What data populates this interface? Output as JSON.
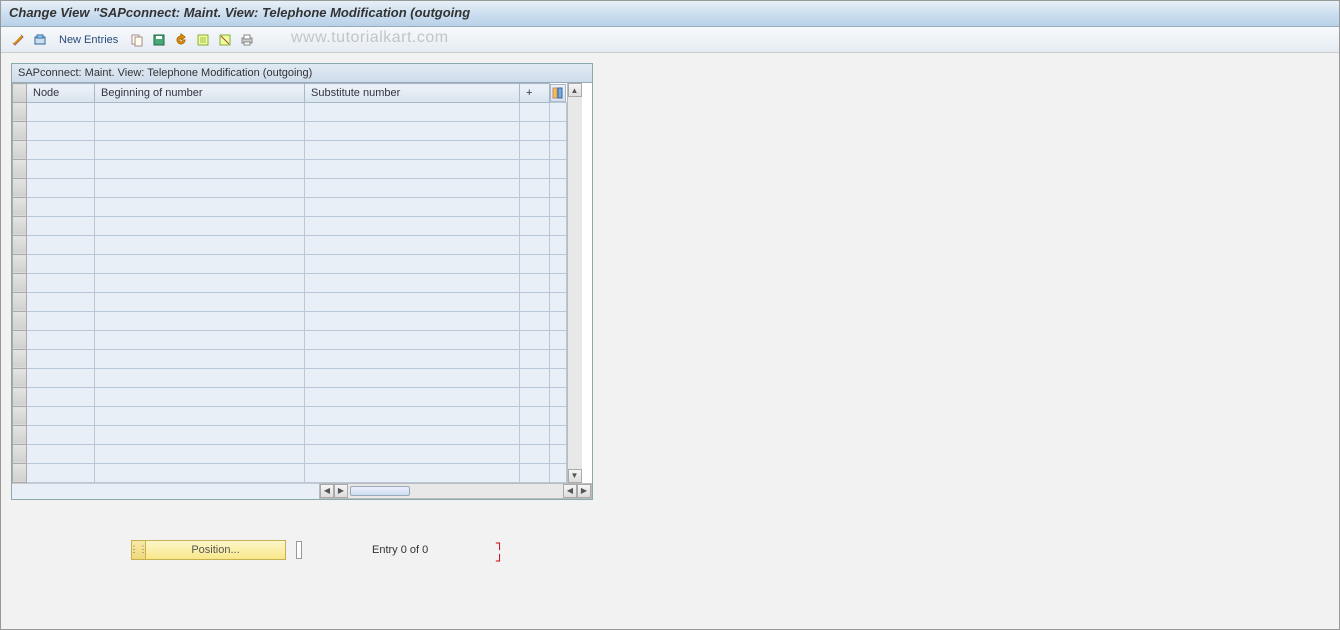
{
  "title": "Change View \"SAPconnect: Maint. View: Telephone Modification (outgoing",
  "toolbar": {
    "new_entries_label": "New Entries"
  },
  "panel": {
    "header": "SAPconnect: Maint. View: Telephone Modification (outgoing)",
    "columns": {
      "node": "Node",
      "beginning": "Beginning of number",
      "substitute": "Substitute number",
      "plus": "+"
    }
  },
  "position_button": "Position...",
  "entry_text": "Entry 0 of 0",
  "watermark": "www.tutorialkart.com",
  "row_count": 20
}
